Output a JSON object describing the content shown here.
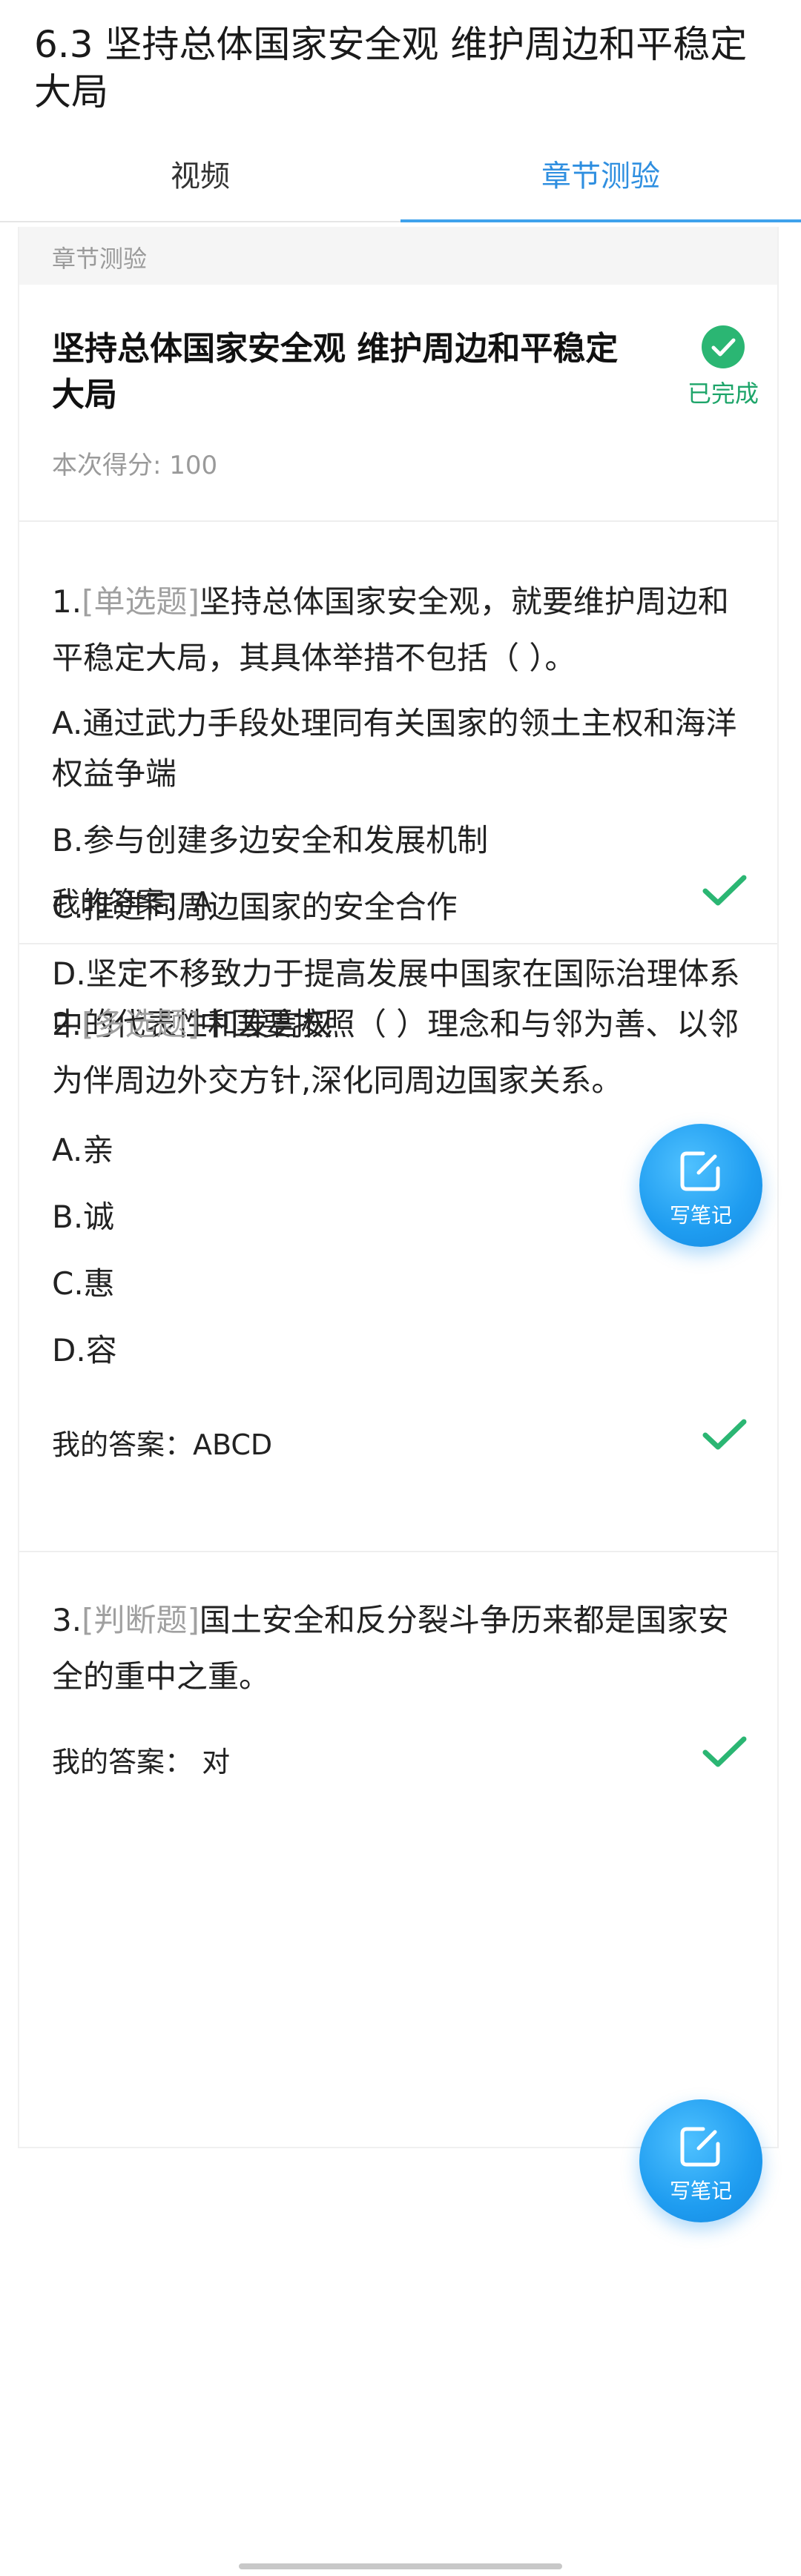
{
  "page": {
    "title": "6.3 坚持总体国家安全观 维护周边和平稳定大局"
  },
  "tabs": [
    {
      "label": "视频",
      "active": false
    },
    {
      "label": "章节测验",
      "active": true
    }
  ],
  "colors": {
    "accent": "#2f8fe0",
    "success": "#1ea56a",
    "check": "#2bb673"
  },
  "section": {
    "label": "章节测验"
  },
  "quiz": {
    "title": "坚持总体国家安全观 维护周边和平稳定大局",
    "status": "已完成",
    "score": "本次得分: 100"
  },
  "questions": [
    {
      "number": "1.",
      "type": "[单选题]",
      "stem": "坚持总体国家安全观，就要维护周边和平稳定大局，其具体举措不包括（ ）。",
      "options": [
        "A.通过武力手段处理同有关国家的领土主权和海洋权益争端",
        "B.参与创建多边安全和发展机制",
        "C.推进同周边国家的安全合作",
        "D.坚定不移致力于提高发展中国家在国际治理体系中的代表性和发言权"
      ],
      "answer": "我的答案：A"
    },
    {
      "number": "2.",
      "type": "[多选题]",
      "stem": "中国要按照（ ）理念和与邻为善、以邻为伴周边外交方针,深化同周边国家关系。",
      "options": [
        "A.亲",
        "B.诚",
        "C.惠",
        "D.容"
      ],
      "answer": "我的答案：ABCD"
    },
    {
      "number": "3.",
      "type": "[判断题]",
      "stem": "国土安全和反分裂斗争历来都是国家安全的重中之重。",
      "options": [],
      "answer": "我的答案： 对"
    }
  ],
  "note_button": {
    "label": "写笔记",
    "icon": "edit-note-icon"
  }
}
